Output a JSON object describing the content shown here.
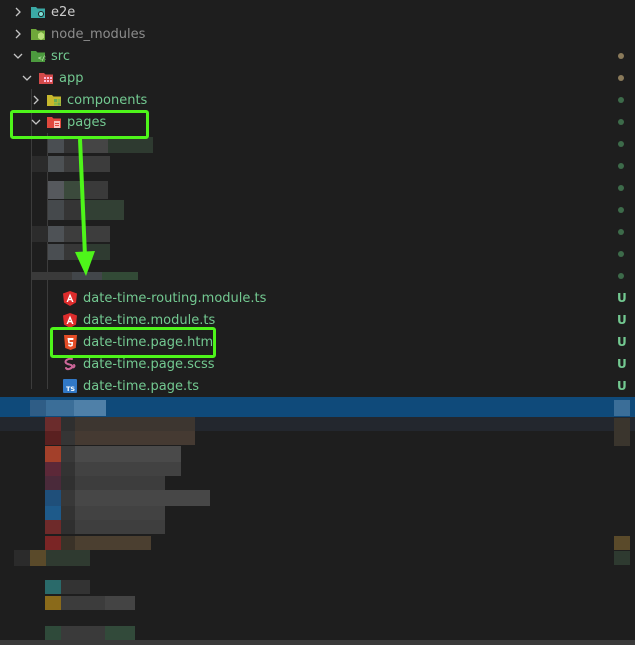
{
  "explorer": {
    "items": {
      "e2e": "e2e",
      "node_modules": "node_modules",
      "src": "src",
      "app": "app",
      "components": "components",
      "pages": "pages",
      "routing": "date-time-routing.module.ts",
      "module": "date-time.module.ts",
      "html": "date-time.page.html",
      "scss": "date-time.page.scss",
      "ts": "date-time.page.ts"
    },
    "status_untracked": "U",
    "ts_icon_text": "TS"
  },
  "colors": {
    "background": "#1e1e1e",
    "untracked_green": "#73c991",
    "modified_dot": "#8a7a5a",
    "annotation_green": "#4ef51a",
    "selection_blue": "#0f4a7a"
  }
}
